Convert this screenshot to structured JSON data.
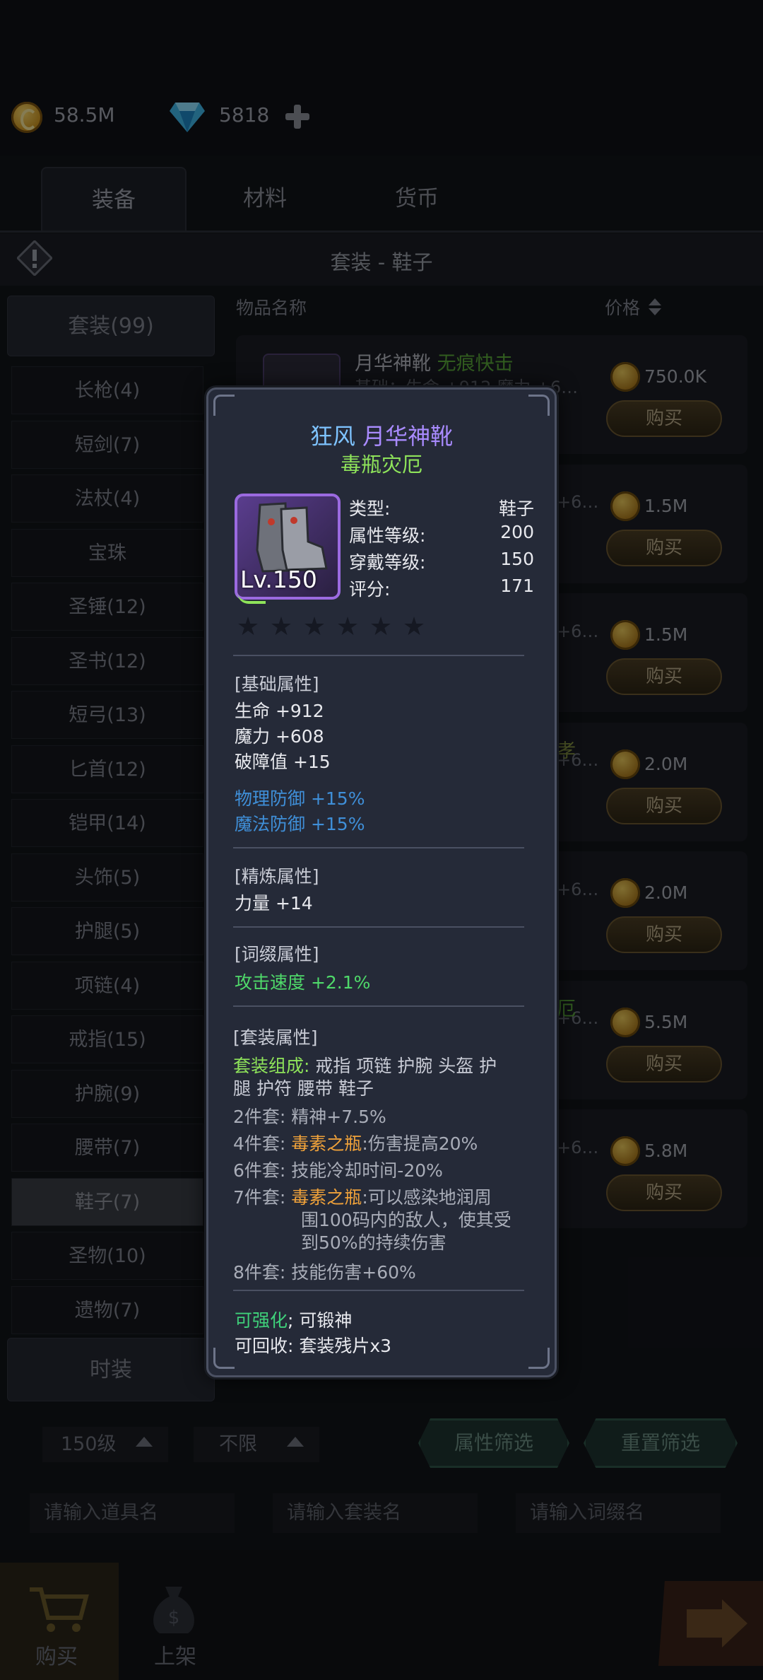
{
  "currency": {
    "gold": "58.5M",
    "gems": "5818"
  },
  "tabs": [
    "装备",
    "材料",
    "货币"
  ],
  "category_title": "套装 - 鞋子",
  "sidebar": {
    "header": "套装(99)",
    "items": [
      "长枪(4)",
      "短剑(7)",
      "法杖(4)",
      "宝珠",
      "圣锤(12)",
      "圣书(12)",
      "短弓(13)",
      "匕首(12)",
      "铠甲(14)",
      "头饰(5)",
      "护腿(5)",
      "项链(4)",
      "戒指(15)",
      "护腕(9)",
      "腰带(7)",
      "鞋子(7)",
      "圣物(10)",
      "遗物(7)"
    ],
    "footer": "时装"
  },
  "list": {
    "col_name": "物品名称",
    "col_price": "价格",
    "first_item_name": "月华神靴",
    "first_item_affix": "无痕快击",
    "first_item_stats": "基础：生命 +912    魔力 +6…",
    "partial_texts": [
      "孝",
      "厄"
    ],
    "partial_stat": "+6…",
    "prices": [
      "750.0K",
      "1.5M",
      "1.5M",
      "2.0M",
      "2.0M",
      "5.5M",
      "5.8M"
    ],
    "buy_label": "购买"
  },
  "popup": {
    "prefix": "狂风",
    "name": "月华神靴",
    "set_name": "毒瓶灾厄",
    "level_badge": "Lv.150",
    "info": [
      {
        "k": "类型:",
        "v": "鞋子"
      },
      {
        "k": "属性等级:",
        "v": "200"
      },
      {
        "k": "穿戴等级:",
        "v": "150"
      },
      {
        "k": "评分:",
        "v": "171"
      }
    ],
    "stars": 6,
    "base_title": "[基础属性]",
    "base": [
      "生命 +912",
      "魔力 +608",
      "破障值 +15"
    ],
    "base_blue": [
      "物理防御 +15%",
      "魔法防御 +15%"
    ],
    "refine_title": "[精炼属性]",
    "refine": [
      "力量 +14"
    ],
    "affix_title": "[词缀属性]",
    "affix": [
      "攻击速度 +2.1%"
    ],
    "set_title": "[套装属性]",
    "set_comp_label": "套装组成:",
    "set_comp_line1": " 戒指 项链 护腕 头盔 护",
    "set_comp_line2": "腿 护符 腰带 鞋子",
    "set_bonus": [
      {
        "k": "2件套:",
        "v": "精神+7.5%"
      },
      {
        "k": "4件套:",
        "hl": "毒素之瓶",
        "v": ":伤害提高20%"
      },
      {
        "k": "6件套:",
        "v": "技能冷却时间-20%"
      },
      {
        "k": "7件套:",
        "hl": "毒素之瓶",
        "v": ":可以感染地润周",
        "v2": "围100码内的敌人，使其受",
        "v3": "到50%的持续伤害"
      },
      {
        "k": "8件套:",
        "v": "技能伤害+60%"
      }
    ],
    "enhance_a": "可强化",
    "enhance_b": "; 可锻神",
    "recycle": "可回收:  套装残片x3"
  },
  "filters": {
    "level": "150级",
    "limit": "不限",
    "attr_btn": "属性筛选",
    "reset_btn": "重置筛选"
  },
  "inputs": {
    "item": "请输入道具名",
    "set": "请输入套装名",
    "affix": "请输入词缀名"
  },
  "bottom_nav": {
    "buy": "购买",
    "list": "上架"
  }
}
